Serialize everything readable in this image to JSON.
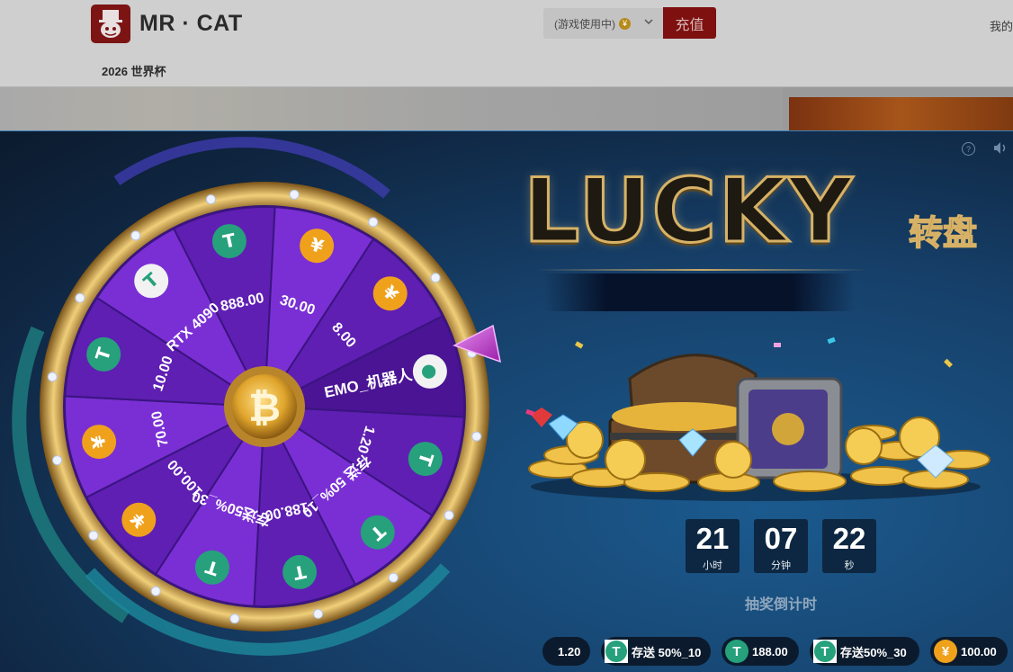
{
  "site": {
    "brand": "MR · CAT",
    "currency_select": "(游戏使用中)",
    "currency_symbol": "¥",
    "deposit_button": "充值",
    "my_account": "我的",
    "nav_item": "2026 世界杯"
  },
  "modal": {
    "title": "LUCKY",
    "title_suffix": "转盘",
    "countdown": {
      "hours": "21",
      "hours_unit": "小时",
      "minutes": "07",
      "minutes_unit": "分钟",
      "seconds": "22",
      "seconds_unit": "秒",
      "label": "抽奖倒计时"
    },
    "wheel": {
      "center_symbol": "₿",
      "segments": [
        {
          "label": "EMO_机器人",
          "icon": "robot-icon"
        },
        {
          "label": "1.20",
          "icon": "usdt-icon"
        },
        {
          "label": "存送 50%_10",
          "icon": "usdt-icon"
        },
        {
          "label": "188.00",
          "icon": "usdt-icon"
        },
        {
          "label": "存送50%_30",
          "icon": "usdt-icon"
        },
        {
          "label": "100.00",
          "icon": "cny-icon"
        },
        {
          "label": "70.00",
          "icon": "cny-icon"
        },
        {
          "label": "10.00",
          "icon": "usdt-icon"
        },
        {
          "label": "RTX 4090",
          "icon": "gpu-icon"
        },
        {
          "label": "888.00",
          "icon": "usdt-icon"
        },
        {
          "label": "30.00",
          "icon": "cny-icon"
        },
        {
          "label": "8.00",
          "icon": "cny-icon"
        }
      ]
    },
    "ticker": [
      {
        "label": "1.20",
        "icon": "usdt-icon"
      },
      {
        "label": "存送 50%_10",
        "icon": "usdt-icon"
      },
      {
        "label": "188.00",
        "icon": "usdt-icon"
      },
      {
        "label": "存送50%_30",
        "icon": "usdt-icon"
      },
      {
        "label": "100.00",
        "icon": "cny-icon"
      }
    ]
  },
  "colors": {
    "usdt": "#26a17b",
    "cny": "#f0a11c",
    "wheel_purple": "#6a23c4",
    "gold": "#d7b266",
    "deposit": "#7e1010"
  }
}
